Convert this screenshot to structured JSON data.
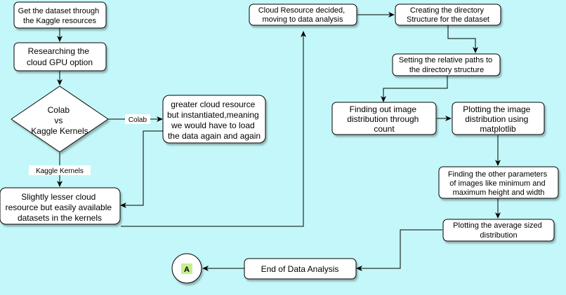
{
  "diagram": {
    "nodes": {
      "get_dataset": [
        "Get the dataset through",
        "the Kaggle resources"
      ],
      "research_gpu": [
        "Researching the",
        "cloud GPU option"
      ],
      "decision": [
        "Colab",
        "vs",
        "Kaggle Kernels"
      ],
      "colab_result": [
        "greater cloud resource",
        "but instantiated,meaning",
        "we would have to load",
        "the data again and again"
      ],
      "kaggle_result": [
        "Slightly lesser cloud",
        "resource but easily available",
        "datasets in the kernels"
      ],
      "cloud_decided": [
        "Cloud Resource decided,",
        "moving to data analysis"
      ],
      "create_dir": [
        "Creating the directory",
        "Structure for the dataset"
      ],
      "relative_paths": [
        "Setting the relative paths to",
        "the directory structure"
      ],
      "image_distribution": [
        "Finding out image",
        "distribution through",
        "count"
      ],
      "plot_distribution": [
        "Plotting the image",
        "distribution using",
        "matplotlib"
      ],
      "other_params": [
        "Finding the other parameters",
        "of images like minimum and",
        "maximum height and width"
      ],
      "plot_average": [
        "Plotting the average sized",
        "distribution"
      ],
      "end_analysis": [
        "End of Data Analysis"
      ],
      "connector": [
        "A"
      ]
    },
    "edge_labels": {
      "colab": "Colab",
      "kaggle_kernels": "Kaggle Kernels"
    }
  }
}
